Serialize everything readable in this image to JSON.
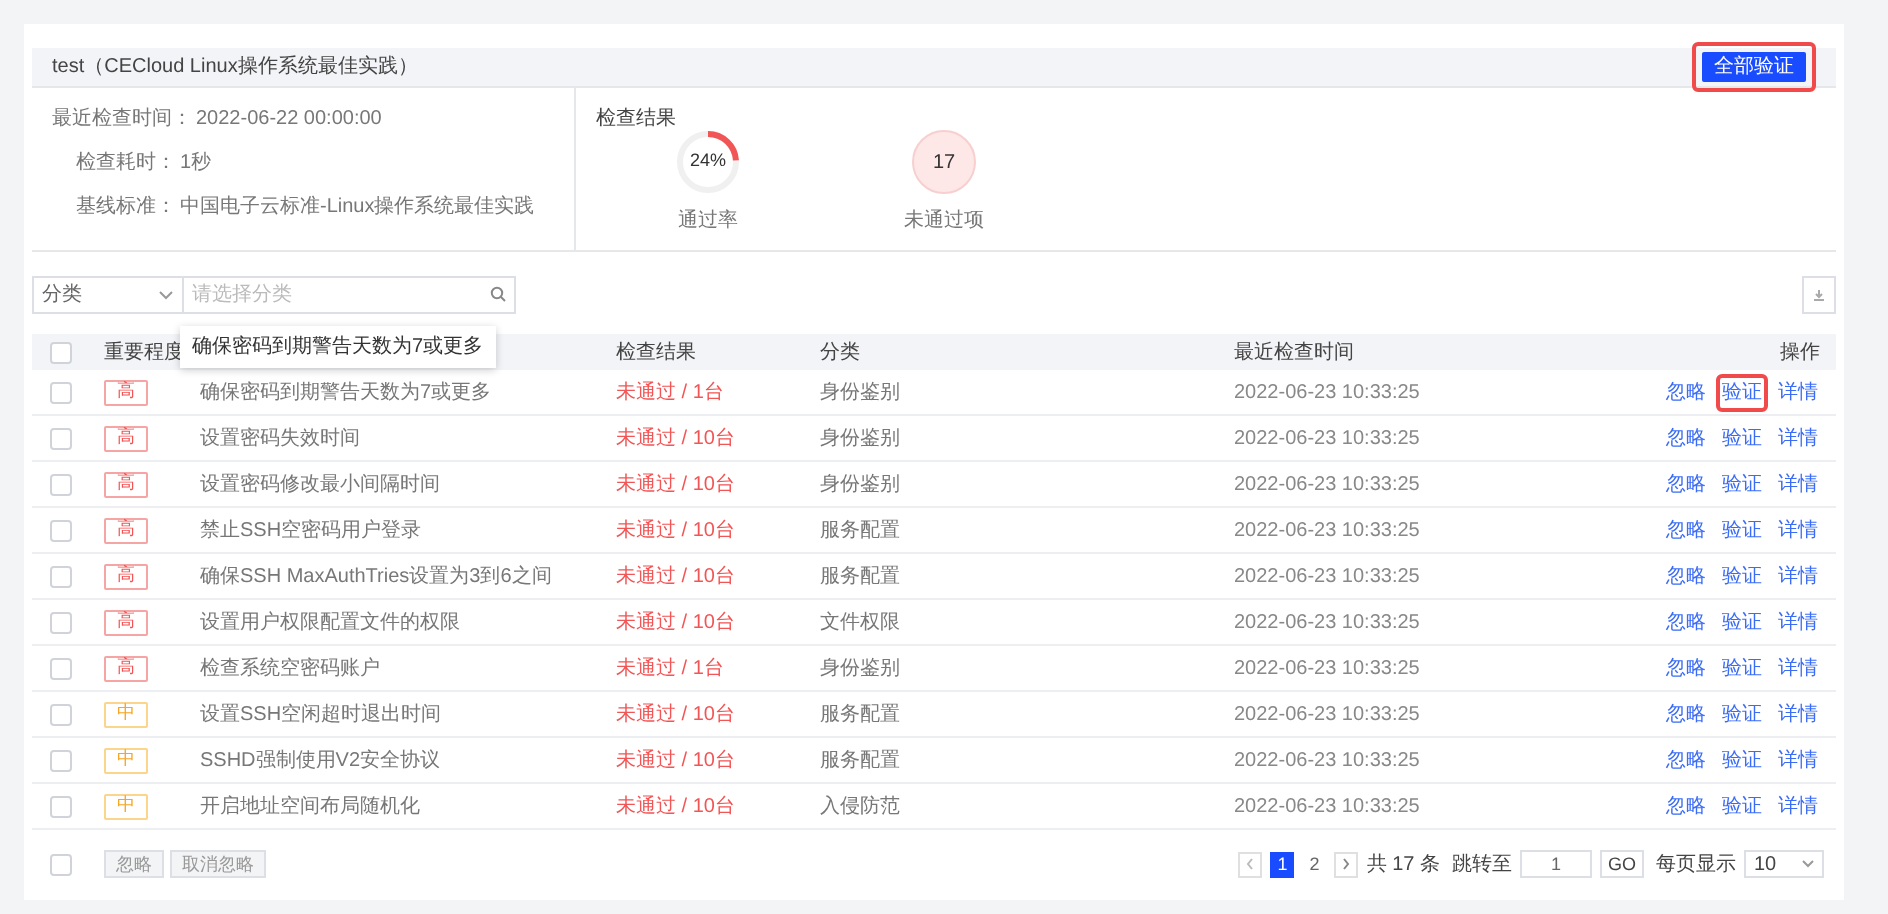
{
  "header": {
    "title": "test（CECloud Linux操作系统最佳实践）",
    "verify_all_button": {
      "label": "全部验证",
      "highlighted": true
    }
  },
  "info": {
    "fields": [
      {
        "label": "最近检查时间：",
        "value": "2022-06-22 00:00:00"
      },
      {
        "label": "检查耗时：",
        "value": "1秒"
      },
      {
        "label": "基线标准：",
        "value": "中国电子云标准-Linux操作系统最佳实践"
      }
    ],
    "result": {
      "title": "检查结果",
      "pass_rate": {
        "value": "24%",
        "level": 0.24,
        "label": "通过率"
      },
      "failed": {
        "value": "17",
        "label": "未通过项"
      }
    }
  },
  "filter": {
    "category_select": "分类",
    "search": {
      "placeholder": "请选择分类"
    }
  },
  "table": {
    "select_all_checked": false,
    "columns": [
      "重要程度",
      "检查结果",
      "分类",
      "最近检查时间",
      "操作"
    ],
    "tooltip": "确保密码到期警告天数为7或更多",
    "rows": [
      {
        "checked": false,
        "severity": {
          "label": "高",
          "kind": "high"
        },
        "item": "确保密码到期警告天数为7或更多",
        "result": "未通过 / 1台",
        "category": "身份鉴别",
        "time": "2022-06-23 10:33:25",
        "actions": [
          {
            "label": "忽略",
            "highlighted": false
          },
          {
            "label": "验证",
            "highlighted": true
          },
          {
            "label": "详情",
            "highlighted": false
          }
        ]
      },
      {
        "checked": false,
        "severity": {
          "label": "高",
          "kind": "high"
        },
        "item": "设置密码失效时间",
        "result": "未通过 / 10台",
        "category": "身份鉴别",
        "time": "2022-06-23 10:33:25",
        "actions": [
          {
            "label": "忽略",
            "highlighted": false
          },
          {
            "label": "验证",
            "highlighted": false
          },
          {
            "label": "详情",
            "highlighted": false
          }
        ]
      },
      {
        "checked": false,
        "severity": {
          "label": "高",
          "kind": "high"
        },
        "item": "设置密码修改最小间隔时间",
        "result": "未通过 / 10台",
        "category": "身份鉴别",
        "time": "2022-06-23 10:33:25",
        "actions": [
          {
            "label": "忽略",
            "highlighted": false
          },
          {
            "label": "验证",
            "highlighted": false
          },
          {
            "label": "详情",
            "highlighted": false
          }
        ]
      },
      {
        "checked": false,
        "severity": {
          "label": "高",
          "kind": "high"
        },
        "item": "禁止SSH空密码用户登录",
        "result": "未通过 / 10台",
        "category": "服务配置",
        "time": "2022-06-23 10:33:25",
        "actions": [
          {
            "label": "忽略",
            "highlighted": false
          },
          {
            "label": "验证",
            "highlighted": false
          },
          {
            "label": "详情",
            "highlighted": false
          }
        ]
      },
      {
        "checked": false,
        "severity": {
          "label": "高",
          "kind": "high"
        },
        "item": "确保SSH MaxAuthTries设置为3到6之间",
        "result": "未通过 / 10台",
        "category": "服务配置",
        "time": "2022-06-23 10:33:25",
        "actions": [
          {
            "label": "忽略",
            "highlighted": false
          },
          {
            "label": "验证",
            "highlighted": false
          },
          {
            "label": "详情",
            "highlighted": false
          }
        ]
      },
      {
        "checked": false,
        "severity": {
          "label": "高",
          "kind": "high"
        },
        "item": "设置用户权限配置文件的权限",
        "result": "未通过 / 10台",
        "category": "文件权限",
        "time": "2022-06-23 10:33:25",
        "actions": [
          {
            "label": "忽略",
            "highlighted": false
          },
          {
            "label": "验证",
            "highlighted": false
          },
          {
            "label": "详情",
            "highlighted": false
          }
        ]
      },
      {
        "checked": false,
        "severity": {
          "label": "高",
          "kind": "high"
        },
        "item": "检查系统空密码账户",
        "result": "未通过 / 1台",
        "category": "身份鉴别",
        "time": "2022-06-23 10:33:25",
        "actions": [
          {
            "label": "忽略",
            "highlighted": false
          },
          {
            "label": "验证",
            "highlighted": false
          },
          {
            "label": "详情",
            "highlighted": false
          }
        ]
      },
      {
        "checked": false,
        "severity": {
          "label": "中",
          "kind": "medium"
        },
        "item": "设置SSH空闲超时退出时间",
        "result": "未通过 / 10台",
        "category": "服务配置",
        "time": "2022-06-23 10:33:25",
        "actions": [
          {
            "label": "忽略",
            "highlighted": false
          },
          {
            "label": "验证",
            "highlighted": false
          },
          {
            "label": "详情",
            "highlighted": false
          }
        ]
      },
      {
        "checked": false,
        "severity": {
          "label": "中",
          "kind": "medium"
        },
        "item": "SSHD强制使用V2安全协议",
        "result": "未通过 / 10台",
        "category": "服务配置",
        "time": "2022-06-23 10:33:25",
        "actions": [
          {
            "label": "忽略",
            "highlighted": false
          },
          {
            "label": "验证",
            "highlighted": false
          },
          {
            "label": "详情",
            "highlighted": false
          }
        ]
      },
      {
        "checked": false,
        "severity": {
          "label": "中",
          "kind": "medium"
        },
        "item": "开启地址空间布局随机化",
        "result": "未通过 / 10台",
        "category": "入侵防范",
        "time": "2022-06-23 10:33:25",
        "actions": [
          {
            "label": "忽略",
            "highlighted": false
          },
          {
            "label": "验证",
            "highlighted": false
          },
          {
            "label": "详情",
            "highlighted": false
          }
        ]
      }
    ]
  },
  "footer": {
    "select_all_checked": false,
    "buttons": [
      "忽略",
      "取消忽略"
    ],
    "pagination": {
      "pages": [
        {
          "label": "1",
          "selected": true
        },
        {
          "label": "2",
          "selected": false
        }
      ],
      "total": "共 17 条",
      "jump_label": "跳转至",
      "jump_value": "1",
      "go": "GO",
      "page_size_label": "每页显示",
      "page_size": "10"
    }
  }
}
